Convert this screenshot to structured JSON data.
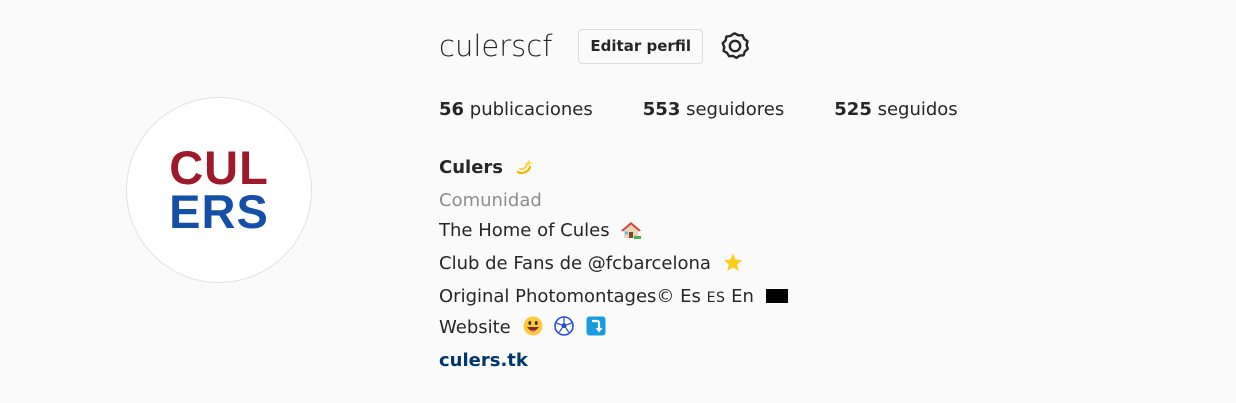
{
  "profile": {
    "username": "culerscf",
    "edit_label": "Editar perfil",
    "avatar_top": "CUL",
    "avatar_bottom": "ERS"
  },
  "stats": {
    "posts_count": "56",
    "posts_label": "publicaciones",
    "followers_count": "553",
    "followers_label": "seguidores",
    "following_count": "525",
    "following_label": "seguidos"
  },
  "bio": {
    "name": "Culers",
    "name_emoji": "dizzy-icon",
    "category": "Comunidad",
    "line1": "The Home of Cules",
    "line1_emoji": "house-icon",
    "line2": "Club de Fans de @fcbarcelona",
    "line2_emoji": "star-icon",
    "line3_prefix": "Original Photomontages© Es",
    "line3_es": "ES",
    "line3_suffix": "En",
    "line4": "Website",
    "link": "culers.tk"
  },
  "colors": {
    "accent_red": "#a0192a",
    "accent_blue": "#1450a8",
    "link": "#00376b",
    "muted": "#8e8e8e"
  }
}
